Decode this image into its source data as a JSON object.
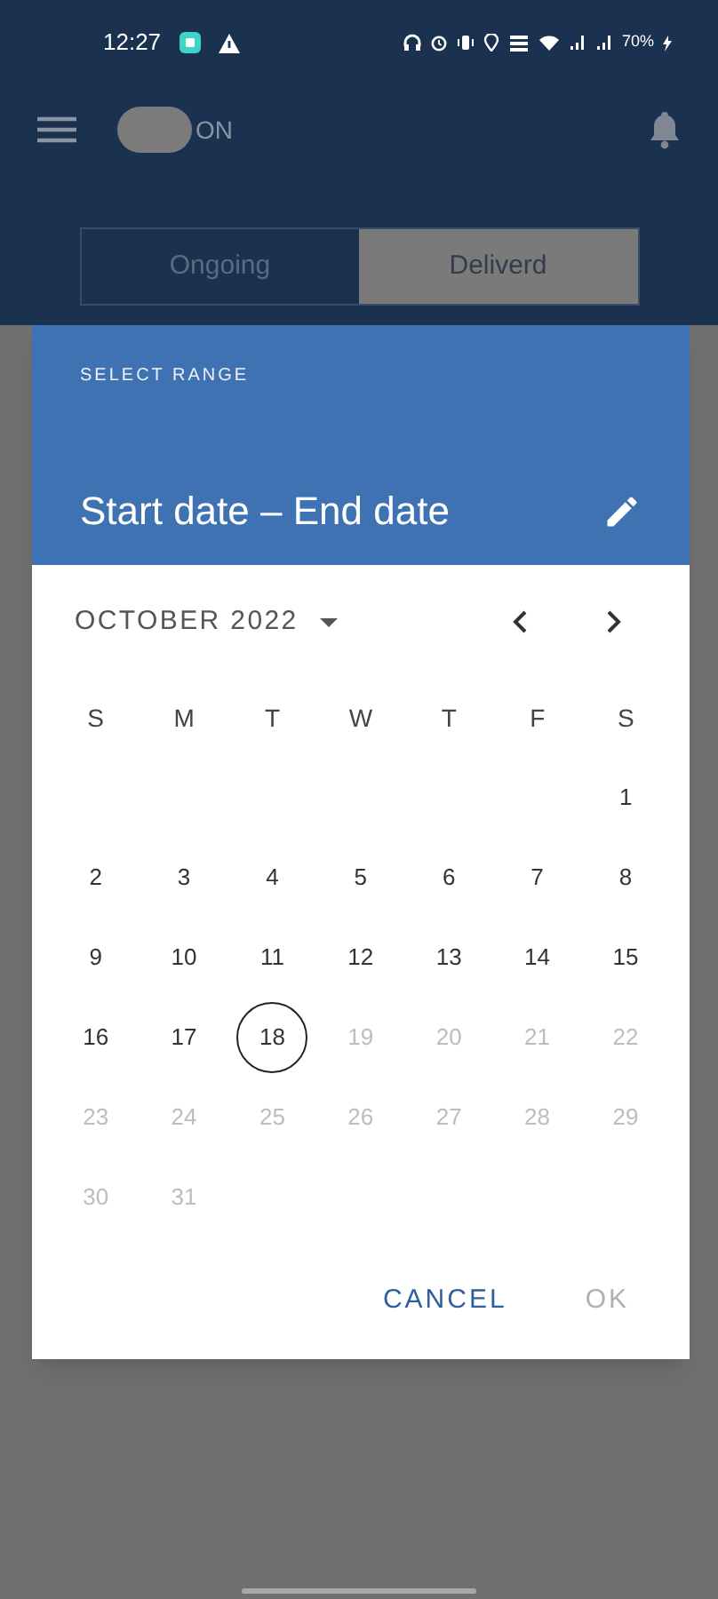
{
  "status_bar": {
    "time": "12:27",
    "battery": "70%"
  },
  "app_bar": {
    "toggle": {
      "on": true,
      "label": "ON"
    }
  },
  "tabs": [
    {
      "label": "Ongoing",
      "selected": false
    },
    {
      "label": "Deliverd",
      "selected": true
    }
  ],
  "dialog": {
    "overline": "SELECT RANGE",
    "title": "Start date – End date",
    "month": "OCTOBER 2022",
    "weekdays": [
      "S",
      "M",
      "T",
      "W",
      "T",
      "F",
      "S"
    ],
    "weeks": [
      {
        "days": [
          {
            "label": "1",
            "today": false,
            "disabled": false
          }
        ]
      },
      {
        "days": [
          {
            "label": "2",
            "today": false,
            "disabled": false
          },
          {
            "label": "3",
            "today": false,
            "disabled": false
          },
          {
            "label": "4",
            "today": false,
            "disabled": false
          },
          {
            "label": "5",
            "today": false,
            "disabled": false
          },
          {
            "label": "6",
            "today": false,
            "disabled": false
          },
          {
            "label": "7",
            "today": false,
            "disabled": false
          },
          {
            "label": "8",
            "today": false,
            "disabled": false
          }
        ]
      },
      {
        "days": [
          {
            "label": "9",
            "today": false,
            "disabled": false
          },
          {
            "label": "10",
            "today": false,
            "disabled": false
          },
          {
            "label": "11",
            "today": false,
            "disabled": false
          },
          {
            "label": "12",
            "today": false,
            "disabled": false
          },
          {
            "label": "13",
            "today": false,
            "disabled": false
          },
          {
            "label": "14",
            "today": false,
            "disabled": false
          },
          {
            "label": "15",
            "today": false,
            "disabled": false
          }
        ]
      },
      {
        "days": [
          {
            "label": "16",
            "today": false,
            "disabled": false
          },
          {
            "label": "17",
            "today": false,
            "disabled": false
          },
          {
            "label": "18",
            "today": true,
            "disabled": false
          },
          {
            "label": "19",
            "today": false,
            "disabled": true
          },
          {
            "label": "20",
            "today": false,
            "disabled": true
          },
          {
            "label": "21",
            "today": false,
            "disabled": true
          },
          {
            "label": "22",
            "today": false,
            "disabled": true
          }
        ]
      },
      {
        "days": [
          {
            "label": "23",
            "today": false,
            "disabled": true
          },
          {
            "label": "24",
            "today": false,
            "disabled": true
          },
          {
            "label": "25",
            "today": false,
            "disabled": true
          },
          {
            "label": "26",
            "today": false,
            "disabled": true
          },
          {
            "label": "27",
            "today": false,
            "disabled": true
          },
          {
            "label": "28",
            "today": false,
            "disabled": true
          },
          {
            "label": "29",
            "today": false,
            "disabled": true
          }
        ]
      },
      {
        "days": [
          {
            "label": "30",
            "today": false,
            "disabled": true
          },
          {
            "label": "31",
            "today": false,
            "disabled": true
          }
        ]
      }
    ],
    "buttons": [
      {
        "label": "CANCEL",
        "disabled": false
      },
      {
        "label": "OK",
        "disabled": true
      }
    ]
  }
}
